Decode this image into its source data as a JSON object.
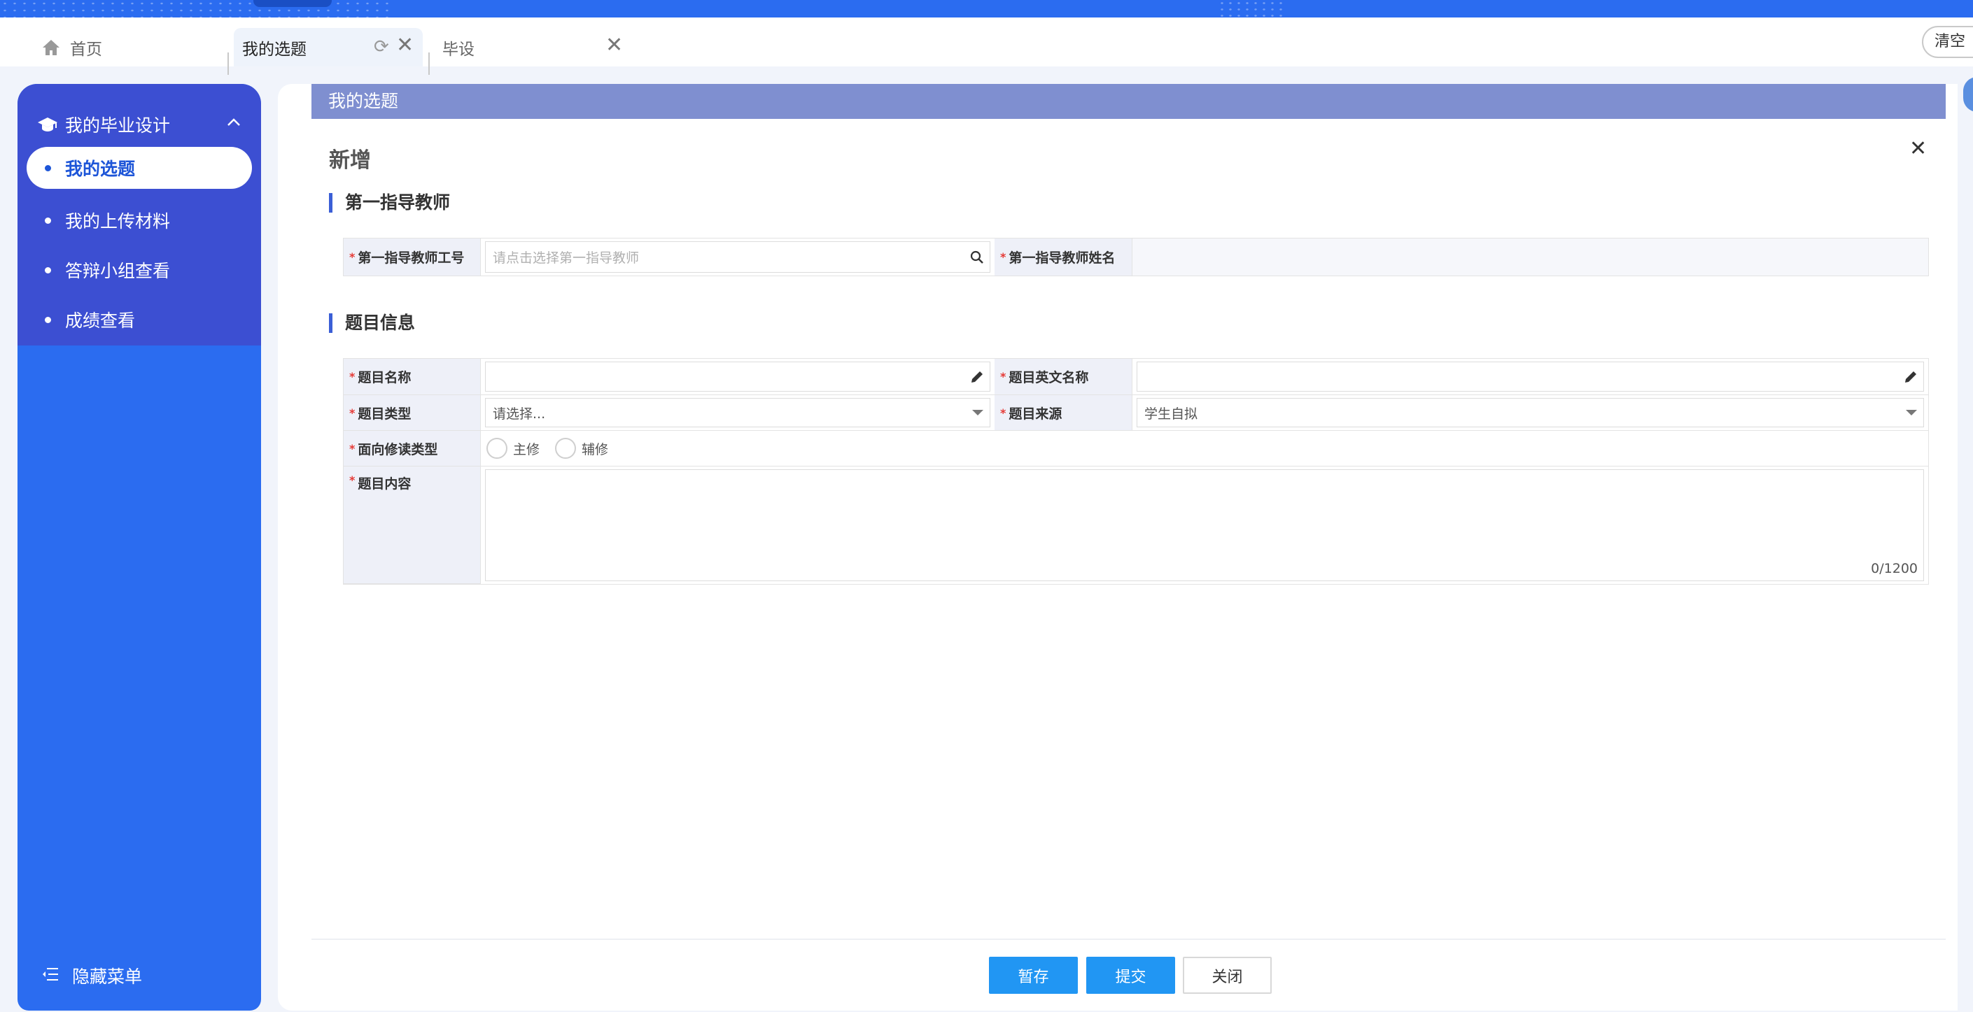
{
  "tabs": [
    {
      "label": "首页",
      "icon": "home-icon"
    },
    {
      "label": "我的选题",
      "icon": "refresh-icon"
    },
    {
      "label": "毕设"
    }
  ],
  "clear_label": "清空",
  "sidebar": {
    "group_label": "我的毕业设计",
    "group_icon": "graduation-cap-icon",
    "items": [
      {
        "label": "我的选题",
        "active": true
      },
      {
        "label": "我的上传材料"
      },
      {
        "label": "答辩小组查看"
      },
      {
        "label": "成绩查看"
      }
    ],
    "hide_menu_label": "隐藏菜单"
  },
  "page_title": "我的选题",
  "dialog": {
    "title": "新增",
    "section1": "第一指导教师",
    "advisor_id_label": "第一指导教师工号",
    "advisor_id_placeholder": "请点击选择第一指导教师",
    "advisor_name_label": "第一指导教师姓名",
    "advisor_name_value": "",
    "section2": "题目信息",
    "topic_name_label": "题目名称",
    "topic_name_value": "",
    "topic_en_label": "题目英文名称",
    "topic_en_value": "",
    "topic_type_label": "题目类型",
    "topic_type_value": "请选择...",
    "topic_source_label": "题目来源",
    "topic_source_value": "学生自拟",
    "study_type_label": "面向修读类型",
    "study_type_options": [
      "主修",
      "辅修"
    ],
    "content_label": "题目内容",
    "content_value": "",
    "content_counter": "0/1200"
  },
  "buttons": {
    "save_draft": "暂存",
    "submit": "提交",
    "close": "关闭"
  },
  "colors": {
    "sidebar_bg": "#2b6cf0",
    "sidebar_group_bg": "#3c4fd2",
    "title_strip": "#7f8fd0",
    "primary_button": "#2196f3",
    "required_mark": "#e53935"
  }
}
